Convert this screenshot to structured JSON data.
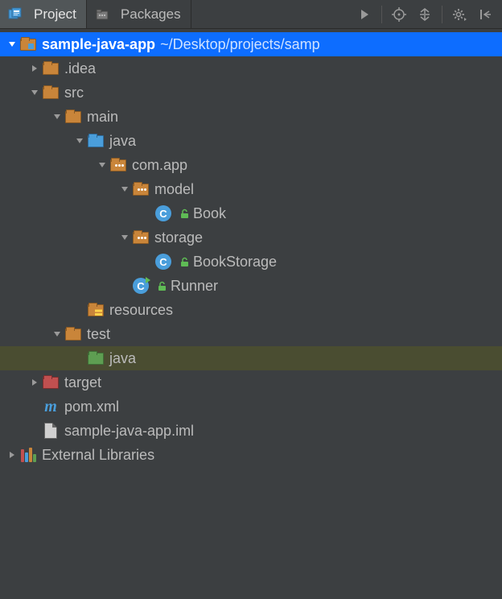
{
  "tabs": {
    "project": "Project",
    "packages": "Packages"
  },
  "tree": {
    "root": {
      "name": "sample-java-app",
      "path": "~/Desktop/projects/samp"
    },
    "idea": ".idea",
    "src": "src",
    "main": "main",
    "java_main": "java",
    "pkg_com_app": "com.app",
    "pkg_model": "model",
    "cls_book": "Book",
    "pkg_storage": "storage",
    "cls_bookstorage": "BookStorage",
    "cls_runner": "Runner",
    "resources": "resources",
    "test": "test",
    "java_test": "java",
    "target": "target",
    "pom": "pom.xml",
    "iml": "sample-java-app.iml",
    "ext_lib": "External Libraries"
  }
}
